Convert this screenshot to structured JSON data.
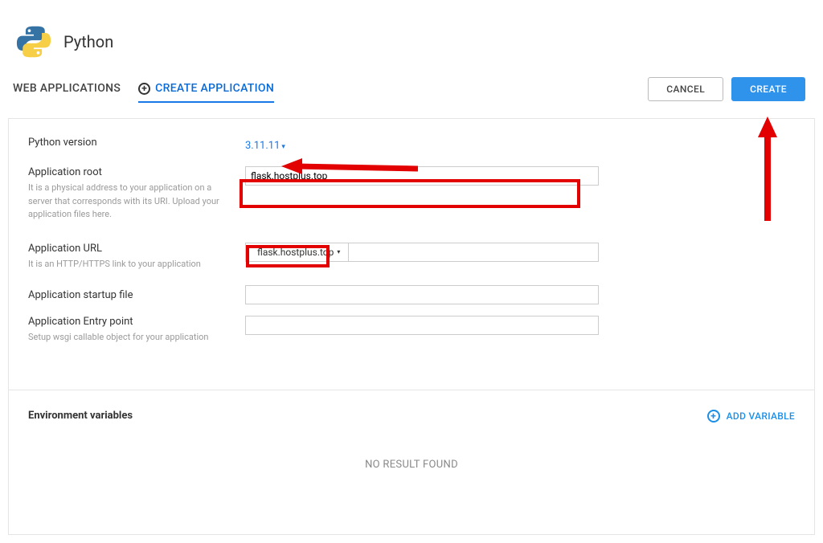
{
  "header": {
    "title": "Python"
  },
  "tabs": {
    "web_apps": "WEB APPLICATIONS",
    "create_app": "CREATE APPLICATION"
  },
  "actions": {
    "cancel": "CANCEL",
    "create": "CREATE"
  },
  "form": {
    "python_version": {
      "label": "Python version",
      "value": "3.11.11"
    },
    "app_root": {
      "label": "Application root",
      "help": "It is a physical address to your application on a server that corresponds with its URI. Upload your application files here.",
      "value": "flask.hostplus.top"
    },
    "app_url": {
      "label": "Application URL",
      "help": "It is an HTTP/HTTPS link to your application",
      "domain": "flask.hostplus.top",
      "path": ""
    },
    "startup_file": {
      "label": "Application startup file",
      "value": ""
    },
    "entry_point": {
      "label": "Application Entry point",
      "help": "Setup wsgi callable object for your application",
      "value": ""
    }
  },
  "env": {
    "title": "Environment variables",
    "add_label": "ADD VARIABLE",
    "empty": "NO RESULT FOUND"
  }
}
